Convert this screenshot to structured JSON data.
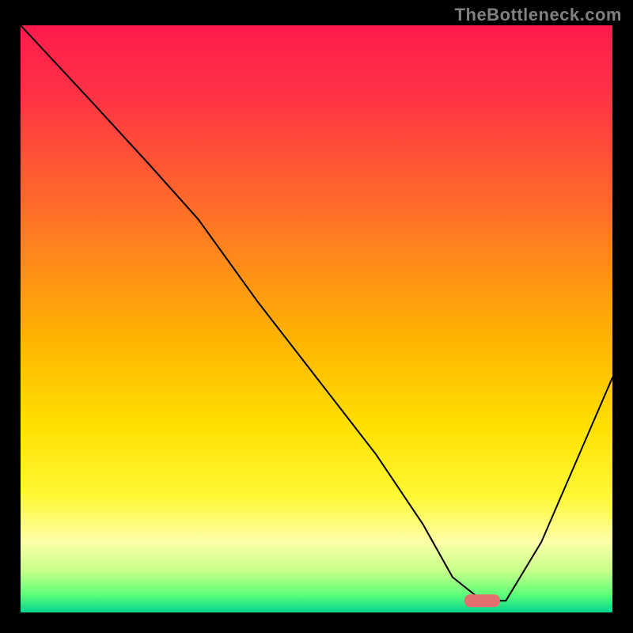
{
  "watermark": "TheBottleneck.com",
  "chart_data": {
    "type": "line",
    "title": "",
    "xlabel": "",
    "ylabel": "",
    "xlim": [
      0,
      100
    ],
    "ylim": [
      0,
      100
    ],
    "background_gradient": {
      "type": "vertical-rainbow",
      "stops": [
        {
          "offset": 0.0,
          "color": "#ff1a4d"
        },
        {
          "offset": 0.12,
          "color": "#ff3344"
        },
        {
          "offset": 0.25,
          "color": "#ff5a33"
        },
        {
          "offset": 0.4,
          "color": "#ff8a1a"
        },
        {
          "offset": 0.55,
          "color": "#ffb800"
        },
        {
          "offset": 0.68,
          "color": "#ffe000"
        },
        {
          "offset": 0.8,
          "color": "#fff833"
        },
        {
          "offset": 0.88,
          "color": "#fcffa8"
        },
        {
          "offset": 0.93,
          "color": "#c6ff8a"
        },
        {
          "offset": 0.97,
          "color": "#5cff78"
        },
        {
          "offset": 1.0,
          "color": "#00d68f"
        }
      ]
    },
    "series": [
      {
        "name": "bottleneck-curve",
        "stroke": "#000000",
        "stroke_width": 2,
        "x": [
          0,
          12,
          22,
          30,
          40,
          50,
          60,
          68,
          73,
          78,
          82,
          88,
          94,
          100
        ],
        "y": [
          100,
          87,
          76,
          67,
          53,
          40,
          27,
          15,
          6,
          2,
          2,
          12,
          26,
          40
        ]
      }
    ],
    "marker": {
      "name": "optimal-marker",
      "shape": "rounded-bar",
      "color": "#e36f6f",
      "x_center": 78,
      "width_pct": 6,
      "y": 2
    }
  }
}
